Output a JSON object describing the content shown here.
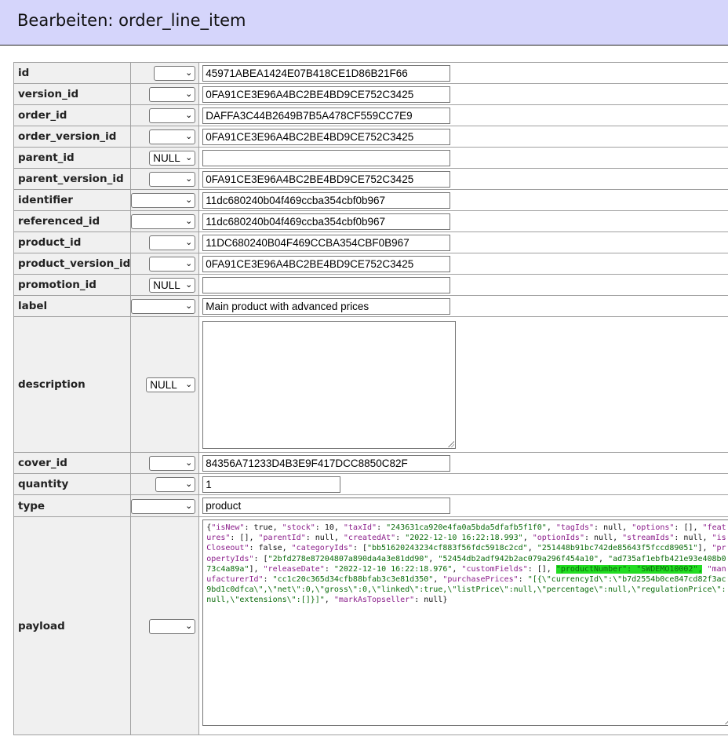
{
  "header": {
    "title": "Bearbeiten: order_line_item"
  },
  "fields": [
    {
      "name": "id",
      "func": "",
      "value": "45971ABEA1424E07B418CE1D86B21F66"
    },
    {
      "name": "version_id",
      "func": "",
      "value": "0FA91CE3E96A4BC2BE4BD9CE752C3425"
    },
    {
      "name": "order_id",
      "func": "",
      "value": "DAFFA3C44B2649B7B5A478CF559CC7E9"
    },
    {
      "name": "order_version_id",
      "func": "",
      "value": "0FA91CE3E96A4BC2BE4BD9CE752C3425"
    },
    {
      "name": "parent_id",
      "func": "NULL",
      "value": ""
    },
    {
      "name": "parent_version_id",
      "func": "",
      "value": "0FA91CE3E96A4BC2BE4BD9CE752C3425"
    },
    {
      "name": "identifier",
      "func": "",
      "value": "11dc680240b04f469ccba354cbf0b967"
    },
    {
      "name": "referenced_id",
      "func": "",
      "value": "11dc680240b04f469ccba354cbf0b967"
    },
    {
      "name": "product_id",
      "func": "",
      "value": "11DC680240B04F469CCBA354CBF0B967"
    },
    {
      "name": "product_version_id",
      "func": "",
      "value": "0FA91CE3E96A4BC2BE4BD9CE752C3425"
    },
    {
      "name": "promotion_id",
      "func": "NULL",
      "value": ""
    },
    {
      "name": "label",
      "func": "",
      "value": "Main product with advanced prices"
    },
    {
      "name": "description",
      "func": "NULL",
      "value": ""
    },
    {
      "name": "cover_id",
      "func": "",
      "value": "84356A71233D4B3E9F417DCC8850C82F"
    },
    {
      "name": "quantity",
      "func": "",
      "value": "1"
    },
    {
      "name": "type",
      "func": "",
      "value": "product"
    },
    {
      "name": "payload",
      "func": ""
    }
  ],
  "payload_tokens": [
    [
      "p",
      "{"
    ],
    [
      "k",
      "\"isNew\""
    ],
    [
      "p",
      ": true, "
    ],
    [
      "k",
      "\"stock\""
    ],
    [
      "p",
      ": 10, "
    ],
    [
      "k",
      "\"taxId\""
    ],
    [
      "p",
      ": "
    ],
    [
      "s",
      "\"243631ca920e4fa0a5bda5dfafb5f1f0\""
    ],
    [
      "p",
      ", "
    ],
    [
      "k",
      "\"tagIds\""
    ],
    [
      "p",
      ": null, "
    ],
    [
      "k",
      "\"options\""
    ],
    [
      "p",
      ": [], "
    ],
    [
      "k",
      "\"features\""
    ],
    [
      "p",
      ": [], "
    ],
    [
      "k",
      "\"parentId\""
    ],
    [
      "p",
      ": null, "
    ],
    [
      "k",
      "\"createdAt\""
    ],
    [
      "p",
      ": "
    ],
    [
      "s",
      "\"2022-12-10 16:22:18.993\""
    ],
    [
      "p",
      ", "
    ],
    [
      "k",
      "\"optionIds\""
    ],
    [
      "p",
      ": null, "
    ],
    [
      "k",
      "\"streamIds\""
    ],
    [
      "p",
      ": null, "
    ],
    [
      "k",
      "\"isCloseout\""
    ],
    [
      "p",
      ": false, "
    ],
    [
      "k",
      "\"categoryIds\""
    ],
    [
      "p",
      ": ["
    ],
    [
      "s",
      "\"bb51620243234cf883f56fdc5918c2cd\""
    ],
    [
      "p",
      ", "
    ],
    [
      "s",
      "\"251448b91bc742de85643f5fccd89051\""
    ],
    [
      "p",
      "], "
    ],
    [
      "k",
      "\"propertyIds\""
    ],
    [
      "p",
      ": ["
    ],
    [
      "s",
      "\"2bfd278e87204807a890da4a3e81dd90\""
    ],
    [
      "p",
      ", "
    ],
    [
      "s",
      "\"52454db2adf942b2ac079a296f454a10\""
    ],
    [
      "p",
      ", "
    ],
    [
      "s",
      "\"ad735af1ebfb421e93e408b073c4a89a\""
    ],
    [
      "p",
      "], "
    ],
    [
      "k",
      "\"releaseDate\""
    ],
    [
      "p",
      ": "
    ],
    [
      "s",
      "\"2022-12-10 16:22:18.976\""
    ],
    [
      "p",
      ", "
    ],
    [
      "k",
      "\"customFields\""
    ],
    [
      "p",
      ": [], "
    ],
    [
      "h",
      "\"productNumber\": \"SWDEMO10002\","
    ],
    [
      "p",
      " "
    ],
    [
      "k",
      "\"manufacturerId\""
    ],
    [
      "p",
      ": "
    ],
    [
      "s",
      "\"cc1c20c365d34cfb88bfab3c3e81d350\""
    ],
    [
      "p",
      ", "
    ],
    [
      "k",
      "\"purchasePrices\""
    ],
    [
      "p",
      ": "
    ],
    [
      "s",
      "\"[{\\\"currencyId\\\":\\\"b7d2554b0ce847cd82f3ac9bd1c0dfca\\\",\\\"net\\\":0,\\\"gross\\\":0,\\\"linked\\\":true,\\\"listPrice\\\":null,\\\"percentage\\\":null,\\\"regulationPrice\\\":null,\\\"extensions\\\":[]}]\""
    ],
    [
      "p",
      ", "
    ],
    [
      "k",
      "\"markAsTopseller\""
    ],
    [
      "p",
      ": null}"
    ]
  ]
}
